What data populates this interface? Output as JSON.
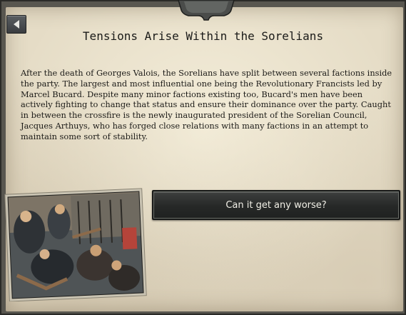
{
  "event": {
    "title": "Tensions Arise Within the Sorelians",
    "description": "After the death of Georges Valois, the Sorelians have split between several factions inside the party. The largest and most influential one being the Revolutionary Francists led by Marcel Bucard. Despite many minor factions existing too, Bucard's men have been actively fighting to change that status and ensure their dominance over the party. Caught in between the crossfire is the newly inaugurated president of the Sorelian Council, Jacques Arthuys, who has forged close relations with many factions in an attempt to maintain some sort of stability.",
    "options": [
      {
        "label": "Can it get any worse?"
      }
    ]
  },
  "icons": {
    "back": "back-arrow-icon"
  },
  "colors": {
    "paper": "#e5dcc6",
    "frame": "#58564f",
    "button": "#262827",
    "button_text": "#f1efe6",
    "text": "#1c1b18"
  }
}
